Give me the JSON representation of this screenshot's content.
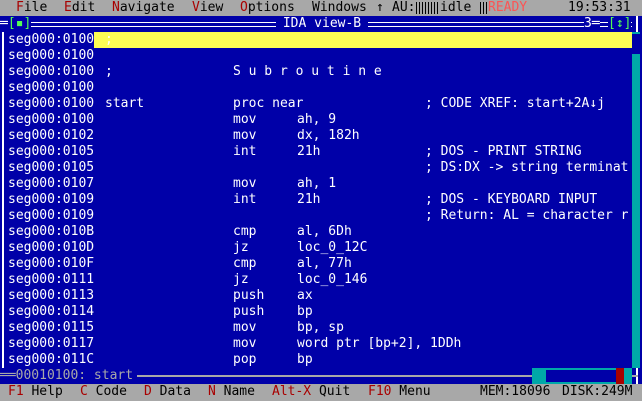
{
  "menubar": {
    "items": [
      {
        "hot": "F",
        "rest": "ile"
      },
      {
        "hot": "E",
        "rest": "dit"
      },
      {
        "hot": "N",
        "rest": "avigate"
      },
      {
        "hot": "V",
        "rest": "iew"
      },
      {
        "hot": "O",
        "rest": "ptions"
      },
      {
        "hot": "",
        "rest": "Windows"
      }
    ],
    "arrow": "↑",
    "au_label": "AU:",
    "au_state": "idle",
    "status": "READY",
    "clock": "19:53:31"
  },
  "window": {
    "title": "IDA view-B",
    "close": "[▪]",
    "number": "3",
    "zoom": "[↕]"
  },
  "listing": [
    {
      "addr": "seg000:0100",
      "label": ";",
      "mn": "",
      "op": "",
      "cm": ""
    },
    {
      "addr": "seg000:0100",
      "label": "",
      "mn": "",
      "op": "",
      "cm": ""
    },
    {
      "addr": "seg000:0100",
      "label": ";",
      "mn": "S u b r o u t i n e",
      "op": "",
      "cm": ""
    },
    {
      "addr": "seg000:0100",
      "label": "",
      "mn": "",
      "op": "",
      "cm": ""
    },
    {
      "addr": "seg000:0100",
      "label": "start",
      "mn": "proc near",
      "op": "",
      "cm": "; CODE XREF: start+2A↓j"
    },
    {
      "addr": "seg000:0100",
      "label": "",
      "mn": "mov",
      "op": "ah, 9",
      "cm": ""
    },
    {
      "addr": "seg000:0102",
      "label": "",
      "mn": "mov",
      "op": "dx, 182h",
      "cm": ""
    },
    {
      "addr": "seg000:0105",
      "label": "",
      "mn": "int",
      "op": "21h",
      "cm": "; DOS - PRINT STRING"
    },
    {
      "addr": "seg000:0105",
      "label": "",
      "mn": "",
      "op": "",
      "cm": "; DS:DX -> string terminat"
    },
    {
      "addr": "seg000:0107",
      "label": "",
      "mn": "mov",
      "op": "ah, 1",
      "cm": ""
    },
    {
      "addr": "seg000:0109",
      "label": "",
      "mn": "int",
      "op": "21h",
      "cm": "; DOS - KEYBOARD INPUT"
    },
    {
      "addr": "seg000:0109",
      "label": "",
      "mn": "",
      "op": "",
      "cm": "; Return: AL = character r"
    },
    {
      "addr": "seg000:010B",
      "label": "",
      "mn": "cmp",
      "op": "al, 6Dh",
      "cm": ""
    },
    {
      "addr": "seg000:010D",
      "label": "",
      "mn": "jz",
      "op": "loc_0_12C",
      "cm": ""
    },
    {
      "addr": "seg000:010F",
      "label": "",
      "mn": "cmp",
      "op": "al, 77h",
      "cm": ""
    },
    {
      "addr": "seg000:0111",
      "label": "",
      "mn": "jz",
      "op": "loc_0_146",
      "cm": ""
    },
    {
      "addr": "seg000:0113",
      "label": "",
      "mn": "push",
      "op": "ax",
      "cm": ""
    },
    {
      "addr": "seg000:0114",
      "label": "",
      "mn": "push",
      "op": "bp",
      "cm": ""
    },
    {
      "addr": "seg000:0115",
      "label": "",
      "mn": "mov",
      "op": "bp, sp",
      "cm": ""
    },
    {
      "addr": "seg000:0117",
      "label": "",
      "mn": "mov",
      "op": "word ptr [bp+2], 1DDh",
      "cm": ""
    },
    {
      "addr": "seg000:011C",
      "label": "",
      "mn": "pop",
      "op": "bp",
      "cm": ""
    }
  ],
  "statusline": "00010100: start",
  "fkeys": [
    {
      "key": "F1",
      "label": " Help"
    },
    {
      "key": "C",
      "label": " Code"
    },
    {
      "key": "D",
      "label": " Data"
    },
    {
      "key": "N",
      "label": " Name"
    },
    {
      "key": "Alt-X",
      "label": " Quit"
    },
    {
      "key": "F10",
      "label": " Menu"
    }
  ],
  "mem": "MEM:18096",
  "disk": "DISK:249M",
  "colors": {
    "bg": "#0000a8",
    "highlight": "#fcfc54",
    "hotkey": "#a80000",
    "bar": "#a8a8a8"
  }
}
